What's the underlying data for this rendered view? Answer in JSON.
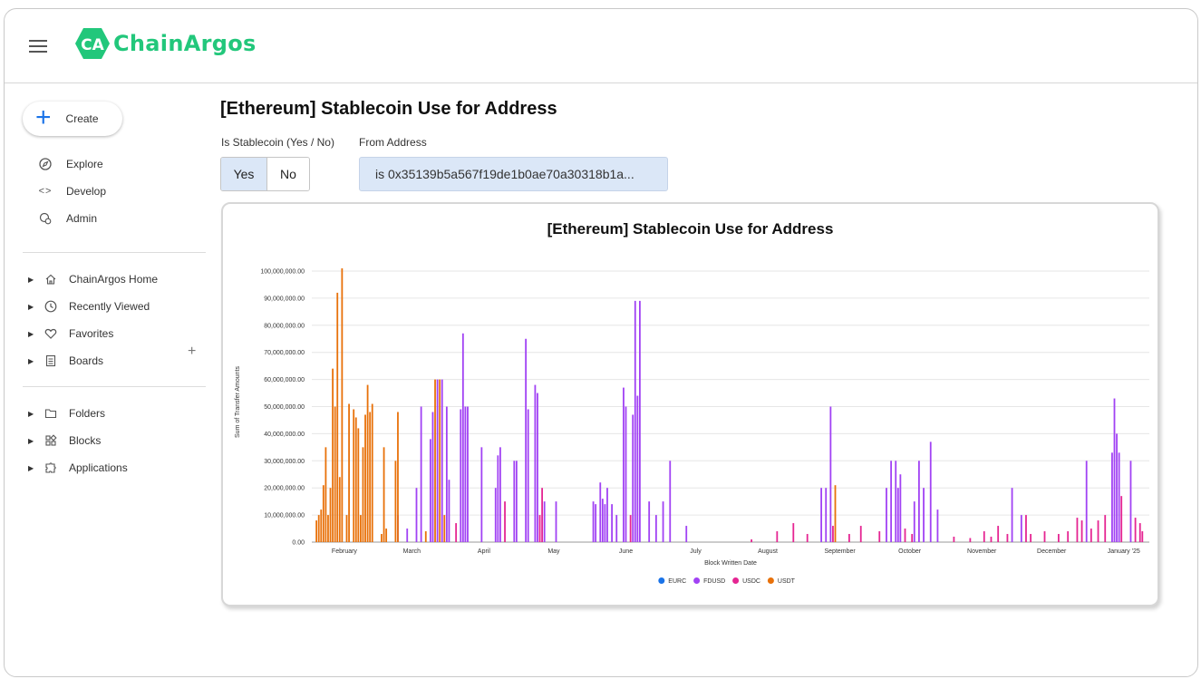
{
  "app": {
    "logo_text": "ChainArgos",
    "logo_mark": "CA"
  },
  "sidebar": {
    "create_label": "Create",
    "nav": [
      {
        "label": "Explore",
        "icon": "compass-icon"
      },
      {
        "label": "Develop",
        "icon": "code-icon"
      },
      {
        "label": "Admin",
        "icon": "admin-gear-icon"
      }
    ],
    "tree": [
      {
        "label": "ChainArgos Home",
        "icon": "home-icon"
      },
      {
        "label": "Recently Viewed",
        "icon": "clock-icon"
      },
      {
        "label": "Favorites",
        "icon": "heart-icon"
      },
      {
        "label": "Boards",
        "icon": "board-icon"
      },
      {
        "label": "Folders",
        "icon": "folder-icon"
      },
      {
        "label": "Blocks",
        "icon": "blocks-icon"
      },
      {
        "label": "Applications",
        "icon": "applications-icon"
      }
    ],
    "add_board_symbol": "+"
  },
  "page": {
    "title": "[Ethereum] Stablecoin Use for Address",
    "filters": {
      "stablecoin_label": "Is Stablecoin (Yes / No)",
      "yes_label": "Yes",
      "no_label": "No",
      "address_label": "From Address",
      "address_value": "is 0x35139b5a567f19de1b0ae70a30318b1a..."
    }
  },
  "chart_data": {
    "type": "bar",
    "title": "[Ethereum] Stablecoin Use for Address",
    "xlabel": "Block Written Date",
    "ylabel": "Sum of Transfer Amounts",
    "ylim": [
      0,
      100000000
    ],
    "y_ticks": [
      "0.00",
      "10,000,000.00",
      "20,000,000.00",
      "30,000,000.00",
      "40,000,000.00",
      "50,000,000.00",
      "60,000,000.00",
      "70,000,000.00",
      "80,000,000.00",
      "90,000,000.00",
      "100,000,000.00"
    ],
    "x_range": [
      "2024-01-18",
      "2025-01-12"
    ],
    "x_ticks": [
      {
        "label": "February",
        "date": "2024-02-01"
      },
      {
        "label": "March",
        "date": "2024-03-01"
      },
      {
        "label": "April",
        "date": "2024-04-01"
      },
      {
        "label": "May",
        "date": "2024-05-01"
      },
      {
        "label": "June",
        "date": "2024-06-01"
      },
      {
        "label": "July",
        "date": "2024-07-01"
      },
      {
        "label": "August",
        "date": "2024-08-01"
      },
      {
        "label": "September",
        "date": "2024-09-01"
      },
      {
        "label": "October",
        "date": "2024-10-01"
      },
      {
        "label": "November",
        "date": "2024-11-01"
      },
      {
        "label": "December",
        "date": "2024-12-01"
      },
      {
        "label": "January '25",
        "date": "2025-01-01"
      }
    ],
    "grid": true,
    "legend_position": "bottom",
    "series": [
      {
        "name": "EURC",
        "color": "#1a73e8",
        "points": []
      },
      {
        "name": "FDUSD",
        "color": "#a142f4",
        "points": [
          [
            "2024-02-24",
            10000000
          ],
          [
            "2024-02-28",
            5000000
          ],
          [
            "2024-03-03",
            20000000
          ],
          [
            "2024-03-05",
            50000000
          ],
          [
            "2024-03-09",
            38000000
          ],
          [
            "2024-03-10",
            48000000
          ],
          [
            "2024-03-12",
            60000000
          ],
          [
            "2024-03-14",
            60000000
          ],
          [
            "2024-03-16",
            50000000
          ],
          [
            "2024-03-17",
            23000000
          ],
          [
            "2024-03-22",
            49000000
          ],
          [
            "2024-03-23",
            77000000
          ],
          [
            "2024-03-24",
            50000000
          ],
          [
            "2024-03-25",
            50000000
          ],
          [
            "2024-03-31",
            35000000
          ],
          [
            "2024-04-06",
            20000000
          ],
          [
            "2024-04-07",
            32000000
          ],
          [
            "2024-04-08",
            35000000
          ],
          [
            "2024-04-14",
            30000000
          ],
          [
            "2024-04-15",
            30000000
          ],
          [
            "2024-04-19",
            75000000
          ],
          [
            "2024-04-20",
            49000000
          ],
          [
            "2024-04-23",
            58000000
          ],
          [
            "2024-04-24",
            55000000
          ],
          [
            "2024-04-27",
            15000000
          ],
          [
            "2024-05-02",
            15000000
          ],
          [
            "2024-05-18",
            15000000
          ],
          [
            "2024-05-19",
            14000000
          ],
          [
            "2024-05-21",
            22000000
          ],
          [
            "2024-05-22",
            16000000
          ],
          [
            "2024-05-23",
            14000000
          ],
          [
            "2024-05-24",
            20000000
          ],
          [
            "2024-05-26",
            14000000
          ],
          [
            "2024-05-28",
            10000000
          ],
          [
            "2024-05-31",
            57000000
          ],
          [
            "2024-06-01",
            50000000
          ],
          [
            "2024-06-04",
            47000000
          ],
          [
            "2024-06-05",
            89000000
          ],
          [
            "2024-06-06",
            54000000
          ],
          [
            "2024-06-07",
            89000000
          ],
          [
            "2024-06-11",
            15000000
          ],
          [
            "2024-06-14",
            10000000
          ],
          [
            "2024-06-17",
            15000000
          ],
          [
            "2024-06-20",
            30000000
          ],
          [
            "2024-06-27",
            6000000
          ],
          [
            "2024-08-24",
            20000000
          ],
          [
            "2024-08-26",
            20000000
          ],
          [
            "2024-08-28",
            50000000
          ],
          [
            "2024-09-21",
            20000000
          ],
          [
            "2024-09-23",
            30000000
          ],
          [
            "2024-09-25",
            30000000
          ],
          [
            "2024-09-26",
            20000000
          ],
          [
            "2024-09-27",
            25000000
          ],
          [
            "2024-10-03",
            15000000
          ],
          [
            "2024-10-05",
            30000000
          ],
          [
            "2024-10-07",
            20000000
          ],
          [
            "2024-10-10",
            37000000
          ],
          [
            "2024-10-13",
            12000000
          ],
          [
            "2024-11-14",
            20000000
          ],
          [
            "2024-11-18",
            10000000
          ],
          [
            "2024-12-16",
            30000000
          ],
          [
            "2024-12-27",
            33000000
          ],
          [
            "2024-12-28",
            53000000
          ],
          [
            "2024-12-29",
            40000000
          ],
          [
            "2024-12-30",
            33000000
          ],
          [
            "2025-01-04",
            30000000
          ]
        ]
      },
      {
        "name": "USDC",
        "color": "#e52592",
        "points": [
          [
            "2024-03-20",
            7000000
          ],
          [
            "2024-04-10",
            15000000
          ],
          [
            "2024-04-25",
            10000000
          ],
          [
            "2024-04-26",
            20000000
          ],
          [
            "2024-06-03",
            10000000
          ],
          [
            "2024-07-25",
            1000000
          ],
          [
            "2024-08-05",
            4000000
          ],
          [
            "2024-08-12",
            7000000
          ],
          [
            "2024-08-18",
            3000000
          ],
          [
            "2024-08-29",
            6000000
          ],
          [
            "2024-09-05",
            3000000
          ],
          [
            "2024-09-10",
            6000000
          ],
          [
            "2024-09-18",
            4000000
          ],
          [
            "2024-09-29",
            5000000
          ],
          [
            "2024-10-02",
            3000000
          ],
          [
            "2024-10-20",
            2000000
          ],
          [
            "2024-10-27",
            1500000
          ],
          [
            "2024-11-02",
            4000000
          ],
          [
            "2024-11-05",
            2000000
          ],
          [
            "2024-11-08",
            6000000
          ],
          [
            "2024-11-12",
            3000000
          ],
          [
            "2024-11-20",
            10000000
          ],
          [
            "2024-11-22",
            3000000
          ],
          [
            "2024-11-28",
            4000000
          ],
          [
            "2024-12-04",
            3000000
          ],
          [
            "2024-12-08",
            4000000
          ],
          [
            "2024-12-12",
            9000000
          ],
          [
            "2024-12-14",
            8000000
          ],
          [
            "2024-12-18",
            5000000
          ],
          [
            "2024-12-21",
            8000000
          ],
          [
            "2024-12-24",
            10000000
          ],
          [
            "2024-12-31",
            17000000
          ],
          [
            "2025-01-06",
            9000000
          ],
          [
            "2025-01-08",
            7000000
          ],
          [
            "2025-01-09",
            4000000
          ]
        ]
      },
      {
        "name": "USDT",
        "color": "#e8710a",
        "points": [
          [
            "2024-01-20",
            8000000
          ],
          [
            "2024-01-21",
            10000000
          ],
          [
            "2024-01-22",
            12000000
          ],
          [
            "2024-01-23",
            21000000
          ],
          [
            "2024-01-24",
            35000000
          ],
          [
            "2024-01-25",
            10000000
          ],
          [
            "2024-01-26",
            20000000
          ],
          [
            "2024-01-27",
            64000000
          ],
          [
            "2024-01-28",
            50000000
          ],
          [
            "2024-01-29",
            92000000
          ],
          [
            "2024-01-30",
            24000000
          ],
          [
            "2024-01-31",
            101000000
          ],
          [
            "2024-02-02",
            10000000
          ],
          [
            "2024-02-03",
            51000000
          ],
          [
            "2024-02-05",
            49000000
          ],
          [
            "2024-02-06",
            46000000
          ],
          [
            "2024-02-07",
            42000000
          ],
          [
            "2024-02-08",
            10000000
          ],
          [
            "2024-02-09",
            35000000
          ],
          [
            "2024-02-10",
            47000000
          ],
          [
            "2024-02-11",
            58000000
          ],
          [
            "2024-02-12",
            48000000
          ],
          [
            "2024-02-13",
            51000000
          ],
          [
            "2024-02-17",
            3000000
          ],
          [
            "2024-02-18",
            35000000
          ],
          [
            "2024-02-19",
            5000000
          ],
          [
            "2024-02-23",
            30000000
          ],
          [
            "2024-02-24",
            48000000
          ],
          [
            "2024-03-07",
            4000000
          ],
          [
            "2024-03-11",
            60000000
          ],
          [
            "2024-03-13",
            60000000
          ],
          [
            "2024-03-15",
            10000000
          ],
          [
            "2024-08-30",
            21000000
          ]
        ]
      }
    ]
  }
}
